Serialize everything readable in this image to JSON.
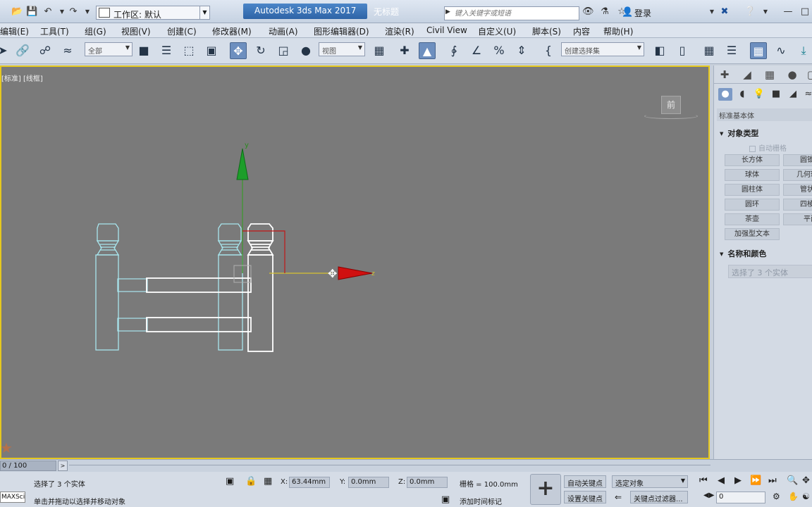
{
  "titlebar": {
    "workspace_label": "工作区: 默认",
    "app_title": "Autodesk 3ds Max 2017",
    "doc_title": "无标题",
    "search_placeholder": "键入关键字或短语",
    "login_label": "登录"
  },
  "menu": [
    {
      "label": "编辑(E)"
    },
    {
      "label": "工具(T)"
    },
    {
      "label": "组(G)"
    },
    {
      "label": "视图(V)"
    },
    {
      "label": "创建(C)"
    },
    {
      "label": "修改器(M)"
    },
    {
      "label": "动画(A)"
    },
    {
      "label": "图形编辑器(D)"
    },
    {
      "label": "渲染(R)"
    },
    {
      "label": "Civil View"
    },
    {
      "label": "自定义(U)"
    },
    {
      "label": "脚本(S)"
    },
    {
      "label": "内容"
    },
    {
      "label": "帮助(H)"
    }
  ],
  "toolbar": {
    "filter_value": "全部",
    "refcoord_value": "视图",
    "named_selection_value": "创建选择集"
  },
  "viewport": {
    "label": "[标准] [线框]",
    "viewcube_label": "前",
    "gizmo_y": "y",
    "gizmo_x": "z"
  },
  "command_panel": {
    "category_value": "标准基本体",
    "object_type_title": "对象类型",
    "autogrid_label": "自动栅格",
    "object_buttons": [
      "长方体",
      "圆锥体",
      "球体",
      "几何球体",
      "圆柱体",
      "管状体",
      "圆环",
      "四棱锥",
      "茶壶",
      "平面",
      "加强型文本"
    ],
    "name_color_title": "名称和颜色",
    "name_value": "选择了 3 个实体"
  },
  "timeline": {
    "frame_label": "0 / 100"
  },
  "status": {
    "selection_text": "选择了 3 个实体",
    "prompt_text": "单击并拖动以选择并移动对象",
    "x_label": "X:",
    "x_value": "63.44mm",
    "y_label": "Y:",
    "y_value": "0.0mm",
    "z_label": "Z:",
    "z_value": "0.0mm",
    "grid_text": "栅格 = 100.0mm",
    "auto_key": "自动关键点",
    "set_key": "设置关键点",
    "selected_dropdown": "选定对象",
    "key_filters": "关键点过滤器...",
    "add_time_tag": "添加时间标记",
    "frame_number": "0",
    "logo_text": "MAXSci"
  }
}
